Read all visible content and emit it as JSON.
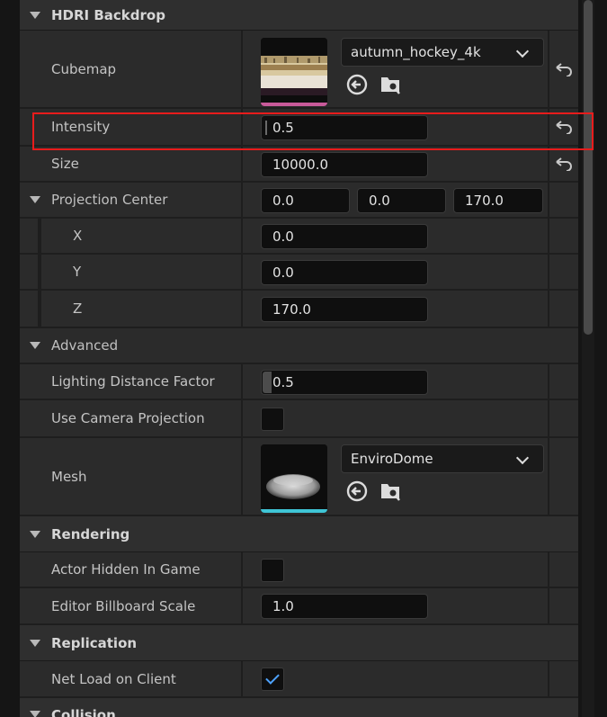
{
  "sections": {
    "hdri": "HDRI Backdrop",
    "advanced": "Advanced",
    "rendering": "Rendering",
    "replication": "Replication",
    "collision": "Collision"
  },
  "properties": {
    "cubemap": {
      "label": "Cubemap",
      "asset": "autumn_hockey_4k"
    },
    "intensity": {
      "label": "Intensity",
      "value": "0.5"
    },
    "size": {
      "label": "Size",
      "value": "10000.0"
    },
    "projection_center": {
      "label": "Projection Center",
      "x": "0.0",
      "y": "0.0",
      "z": "170.0"
    },
    "pc_x": {
      "label": "X",
      "value": "0.0"
    },
    "pc_y": {
      "label": "Y",
      "value": "0.0"
    },
    "pc_z": {
      "label": "Z",
      "value": "170.0"
    },
    "lighting_distance_factor": {
      "label": "Lighting Distance Factor",
      "value": "0.5"
    },
    "use_camera_projection": {
      "label": "Use Camera Projection",
      "checked": false
    },
    "mesh": {
      "label": "Mesh",
      "asset": "EnviroDome"
    },
    "actor_hidden_in_game": {
      "label": "Actor Hidden In Game",
      "checked": false
    },
    "editor_billboard_scale": {
      "label": "Editor Billboard Scale",
      "value": "1.0"
    },
    "net_load_on_client": {
      "label": "Net Load on Client",
      "checked": true
    }
  },
  "icons": {
    "reset": "reset-arrow-icon",
    "browse": "use-selected-asset-icon",
    "find": "browse-to-asset-icon"
  },
  "colors": {
    "highlight": "#e81c1c",
    "check": "#4ea3ff",
    "cubemap_underline": "#c85a9a",
    "mesh_underline": "#3fc5d6"
  }
}
